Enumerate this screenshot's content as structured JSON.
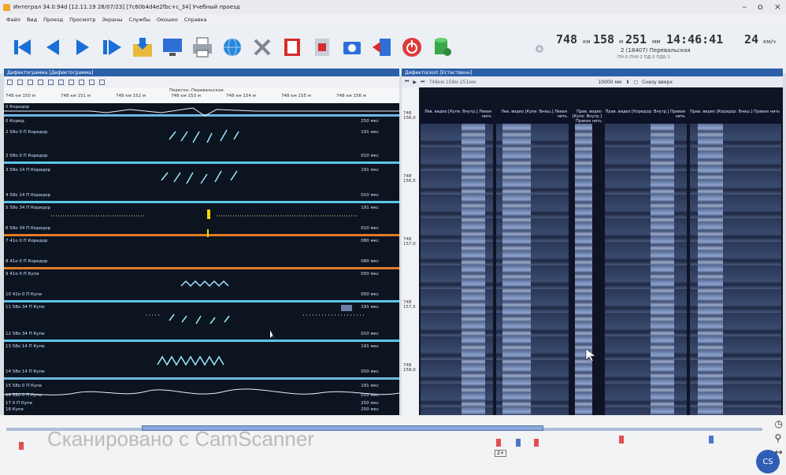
{
  "window": {
    "title": "Интеграл 34.0.94d [12.11.19 28/07/23] [7c60b4d4e2fbc+c_34] Учебный проезд",
    "controls": [
      "–",
      "o",
      "×"
    ]
  },
  "menu": [
    "Файл",
    "Вид",
    "Проезд",
    "Просмотр",
    "Экраны",
    "Службы",
    "Окошко",
    "Справка"
  ],
  "status": {
    "km": "748",
    "km_unit": "км",
    "m": "158",
    "m_unit": "м",
    "offset": "251",
    "offset_unit": "мм",
    "time": "14:46:41",
    "speed": "24",
    "speed_unit": "км/ч",
    "track_info": "2 (18407) Перевальская",
    "track_sub": "ПЧ-5 ПЧУ-2 ПД-3 ПДБ-1"
  },
  "left_panel": {
    "tab": "Дефектограмма [Дефектограмма]",
    "scale_labels": [
      "748 км 150 м",
      "748 км 151 м",
      "748 км 152 м",
      "748 км 153 м",
      "748 км 154 м",
      "748 км 155 м",
      "748 км 156 м"
    ],
    "stage": "Перегон: Перевальская",
    "channels": [
      {
        "label": "0 Коридор",
        "value": ""
      },
      {
        "label": "0 Корид.",
        "value": "250 мкс"
      },
      {
        "label": "2 58о 0 П Коридор",
        "value": "191 мкс"
      },
      {
        "label": "2 58о 0 П Коридор",
        "value": "010 мкс"
      },
      {
        "label": "3 58о 14 П Коридор",
        "value": "191 мкс"
      },
      {
        "label": "4 58о 14 П Коридор",
        "value": "010 мкс"
      },
      {
        "label": "5 58о 34 П Коридор",
        "value": "191 мкс"
      },
      {
        "label": "6 58о 34 П Коридор",
        "value": "010 мкс"
      },
      {
        "label": "7 41о 0 П Коридор",
        "value": "080 мкс"
      },
      {
        "label": "8 41о 0 П Коридор",
        "value": "080 мкс"
      },
      {
        "label": "9 41о 0 П Купе",
        "value": "050 мкс"
      },
      {
        "label": "10 41о 0 П Купе",
        "value": "050 мкс"
      },
      {
        "label": "11 58о 34 П Купе",
        "value": "191 мкс"
      },
      {
        "label": "12 58о 34 П Купе",
        "value": "010 мкс"
      },
      {
        "label": "13 58о 14 П Купе",
        "value": "191 мкс"
      },
      {
        "label": "14 58о 14 П Купе",
        "value": "050 мкс"
      },
      {
        "label": "15 58о 0 П Купе",
        "value": "191 мкс"
      },
      {
        "label": "16 58о 0 П Купе",
        "value": "010 мкс"
      },
      {
        "label": "17 0 П Купе",
        "value": "250 мкс"
      },
      {
        "label": "18 Купе",
        "value": "250 мкс"
      }
    ]
  },
  "right_panel": {
    "tab": "Дефектоскоп [Естественн]",
    "position": "748км 158м 251мм",
    "zoom": "10000 мм",
    "direction": "Снизу вверх",
    "km_marks": [
      "748 156,0",
      "748 156,5",
      "748 157,0",
      "748 157,5",
      "748 158,0"
    ],
    "cameras": [
      "Лев. видео [Купе: Внутр.] Левая нить",
      "Лев. видео [Купе: Внеш.] Левая нить",
      "Прав. видео [Купе: Внутр.] Правая нить",
      "Прав. видео [Коридор: Внутр.] Правая нить",
      "Прав. видео [Коридор: Внеш.] Правая нить"
    ]
  },
  "bottom": {
    "watermark": "Сканировано с CamScanner",
    "marker": "2+",
    "badge": "CS"
  },
  "colors": {
    "accent": "#2a5fa8",
    "play_blue": "#1b6fd8",
    "orange_line": "#e07b28",
    "cyan_line": "#58c7e8"
  }
}
